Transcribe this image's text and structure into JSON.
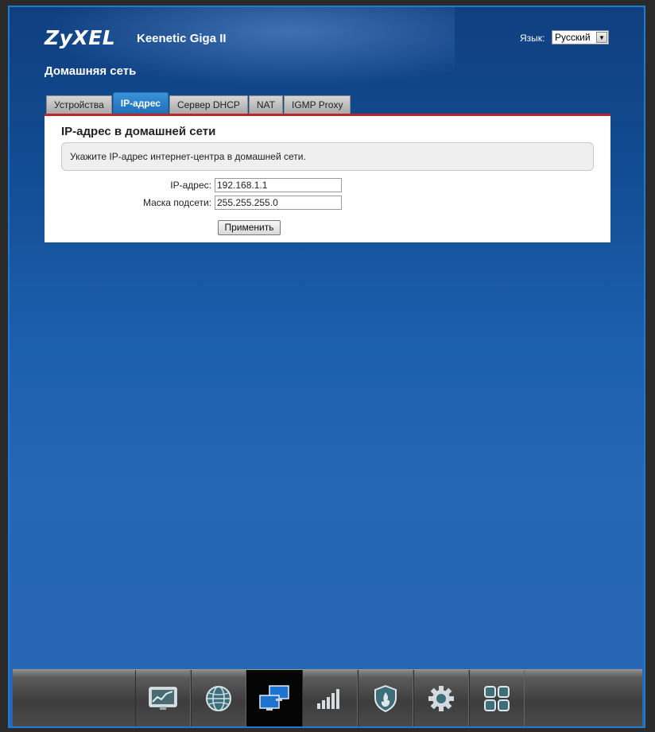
{
  "header": {
    "logo": "ZyXEL",
    "model": "Keenetic Giga II",
    "language_label": "Язык:",
    "language_value": "Русский"
  },
  "page": {
    "title": "Домашняя сеть"
  },
  "tabs": [
    {
      "label": "Устройства",
      "active": false
    },
    {
      "label": "IP-адрес",
      "active": true
    },
    {
      "label": "Сервер DHCP",
      "active": false
    },
    {
      "label": "NAT",
      "active": false
    },
    {
      "label": "IGMP Proxy",
      "active": false
    }
  ],
  "panel": {
    "heading": "IP-адрес в домашней сети",
    "hint": "Укажите IP-адрес интернет-центра в домашней сети.",
    "ip_label": "IP-адрес:",
    "ip_value": "192.168.1.1",
    "mask_label": "Маска подсети:",
    "mask_value": "255.255.255.0",
    "apply_label": "Применить"
  },
  "bottom_nav": [
    {
      "icon": "monitor-chart-icon",
      "active": false
    },
    {
      "icon": "globe-icon",
      "active": false
    },
    {
      "icon": "home-network-icon",
      "active": true
    },
    {
      "icon": "signal-bars-icon",
      "active": false
    },
    {
      "icon": "shield-icon",
      "active": false
    },
    {
      "icon": "gear-icon",
      "active": false
    },
    {
      "icon": "apps-grid-icon",
      "active": false
    }
  ],
  "colors": {
    "accent": "#1d6fb8",
    "panel_border": "#b8262d",
    "background": "#124c92"
  }
}
